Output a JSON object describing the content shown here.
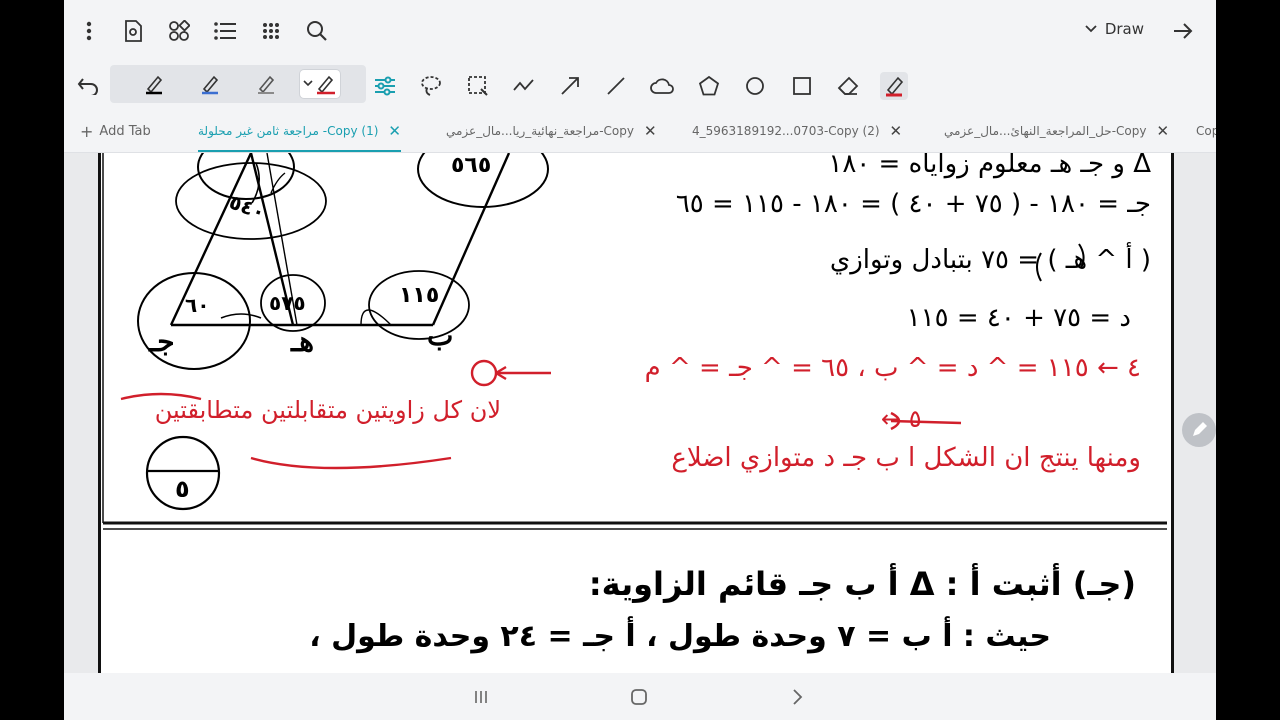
{
  "topbar": {
    "icons": [
      "more-vert-icon",
      "settings-doc-icon",
      "shapes-icon",
      "list-icon",
      "grid-icon",
      "search-icon"
    ],
    "mode_label": "Draw",
    "next_icon": "arrow-right-icon"
  },
  "toolbar": {
    "pens": [
      {
        "name": "pen-black",
        "color": "#000000"
      },
      {
        "name": "pen-blue",
        "color": "#3b6fd1"
      },
      {
        "name": "pen-gray",
        "color": "#8a8a8a"
      },
      {
        "name": "pen-red",
        "color": "#d11f2b"
      }
    ],
    "tools": [
      "sliders-icon",
      "lasso-icon",
      "select-rect-icon",
      "freehand-line-icon",
      "arrow-icon",
      "line-icon",
      "cloud-icon",
      "pentagon-icon",
      "circle-icon",
      "square-icon",
      "eraser-icon",
      "highlighter-icon"
    ],
    "accent_color": "#1a9fb0"
  },
  "tabs": {
    "add_label": "Add Tab",
    "items": [
      {
        "label": "مراجعة ثامن غير محلولة -Copy (1)",
        "active": true
      },
      {
        "label": "مراجعة_نهائية_ريا...مال_عزمي-Copy",
        "active": false
      },
      {
        "label": "4_5963189192...0703-Copy (2)",
        "active": false
      },
      {
        "label": "حل_المراجعة_النهائ...مال_عزمي-Copy",
        "active": false
      },
      {
        "label": "Cop",
        "active": false
      }
    ]
  },
  "document": {
    "labels": {
      "vertex_j": "جـ",
      "vertex_h": "هـ",
      "vertex_b": "ب",
      "angle_565": "٥٦٥",
      "angle_540": "٥٤٠",
      "angle_75": "٥٧٥",
      "angle_115": "١١٥",
      "angle_60": "٦٠"
    },
    "handwriting_black": [
      "Δ و جـ هـ معلوم زواياه = ١٨٠",
      "جـ = ١٨٠ - ( ٧٥ + ٤٠ ) = ١٨٠ - ١١٥ = ٦٥",
      "( أ ^ هـ ) = ٧٥ بتبادل وتوازي",
      "د = ٧٥ + ٤٠ = ١١٥"
    ],
    "handwriting_red": [
      "٤ ← ١١٥ = ^ د = ^ ب ، ٦٥ = ^ جـ = ^ م",
      "٥ ←",
      "ومنها ينتج ان الشكل ا ب جـ د متوازي اضلاع",
      "لان كل زاويتين متقابلتين متطابقتين"
    ],
    "score_value": "٥",
    "question": {
      "line1": "(جـ)  أثبت أ : Δ أ ب جـ قائم الزاوية:",
      "line2": "حيث : أ ب = ٧ وحدة طول ، أ جـ = ٢٤ وحدة طول ،"
    }
  },
  "navbar": {
    "icons": [
      "recents-icon",
      "home-icon",
      "back-icon"
    ]
  }
}
